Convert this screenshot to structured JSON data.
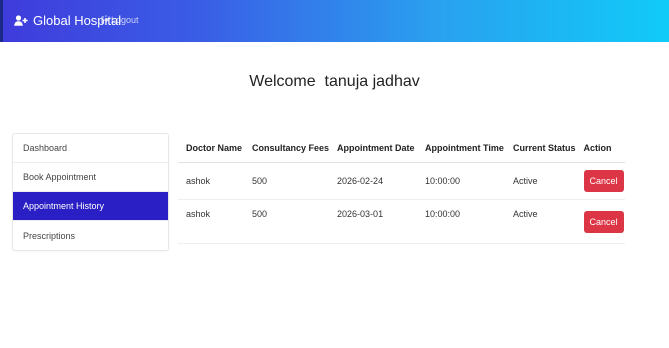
{
  "navbar": {
    "brand": "Global Hospital",
    "logout": "Logout",
    "brand_icon": "user-plus-icon",
    "logout_icon": "sign-out-icon"
  },
  "welcome": {
    "prefix": "Welcome",
    "user": "tanuja jadhav"
  },
  "sidebar": {
    "items": [
      {
        "label": "Dashboard"
      },
      {
        "label": "Book Appointment"
      },
      {
        "label": "Appointment History"
      },
      {
        "label": "Prescriptions"
      }
    ],
    "active_index": 2
  },
  "table": {
    "headers": [
      "Doctor Name",
      "Consultancy Fees",
      "Appointment Date",
      "Appointment Time",
      "Current Status",
      "Action"
    ],
    "rows": [
      {
        "doctor": "ashok",
        "fees": "500",
        "date": "2026-02-24",
        "time": "10:00:00",
        "status": "Active",
        "action": "Cancel"
      },
      {
        "doctor": "ashok",
        "fees": "500",
        "date": "2026-03-01",
        "time": "10:00:00",
        "status": "Active",
        "action": "Cancel"
      }
    ]
  },
  "colors": {
    "nav_gradient_start": "#3f3bdc",
    "nav_gradient_end": "#10cbf8",
    "active_sidebar": "#2a1fc4",
    "cancel_button": "#dc3545"
  }
}
